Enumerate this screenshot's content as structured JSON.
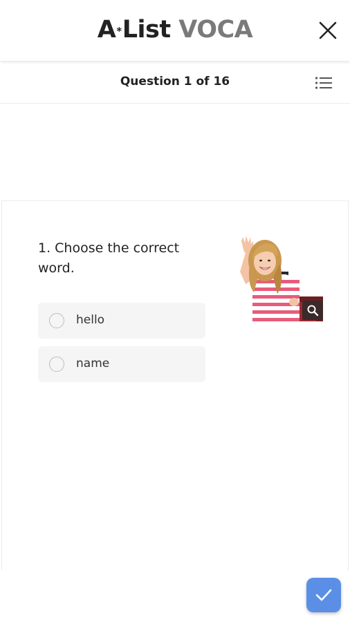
{
  "header": {
    "title_part1": "A",
    "title_star": "*",
    "title_part2": "List",
    "title_part3": "VOCA",
    "close_icon": "close-icon"
  },
  "subheader": {
    "counter": "Question 1 of 16",
    "list_icon": "list-icon"
  },
  "question": {
    "text": "1. Choose the correct word.",
    "image": "girl waving with backpack",
    "zoom_icon": "magnifier-icon",
    "options": [
      {
        "label": "hello"
      },
      {
        "label": "name"
      }
    ]
  },
  "footer": {
    "submit_icon": "checkmark-icon"
  },
  "colors": {
    "accent": "#5b8fe6",
    "title_dark": "#222222",
    "title_gray": "#7a7a7a",
    "option_bg": "#f5f5f5"
  }
}
